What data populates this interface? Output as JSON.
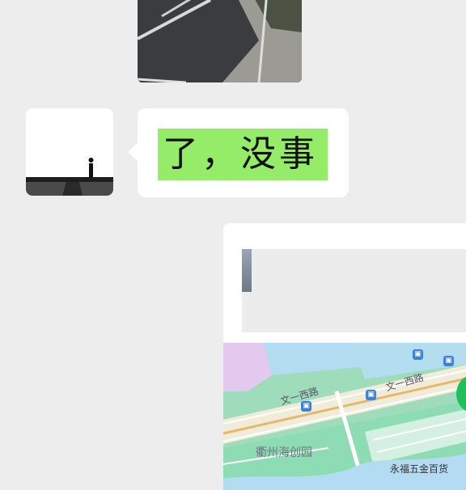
{
  "conversation": {
    "messages": [
      {
        "type": "image",
        "description_icon": "street-photo"
      },
      {
        "type": "text",
        "text": "了，没事",
        "highlight_color": "#95ec69"
      },
      {
        "type": "location"
      }
    ]
  },
  "map": {
    "road_label_1": "文一西路",
    "road_label_2": "文一西路",
    "poi_1": "衢州海创园",
    "poi_2": "永福五金百货"
  },
  "colors": {
    "background": "#ededed",
    "bubble": "#ffffff",
    "text_highlight": "#95ec69",
    "map_water": "#b2dbf0",
    "map_green": "#8ddcad",
    "bus_stop": "#3d82d6"
  }
}
